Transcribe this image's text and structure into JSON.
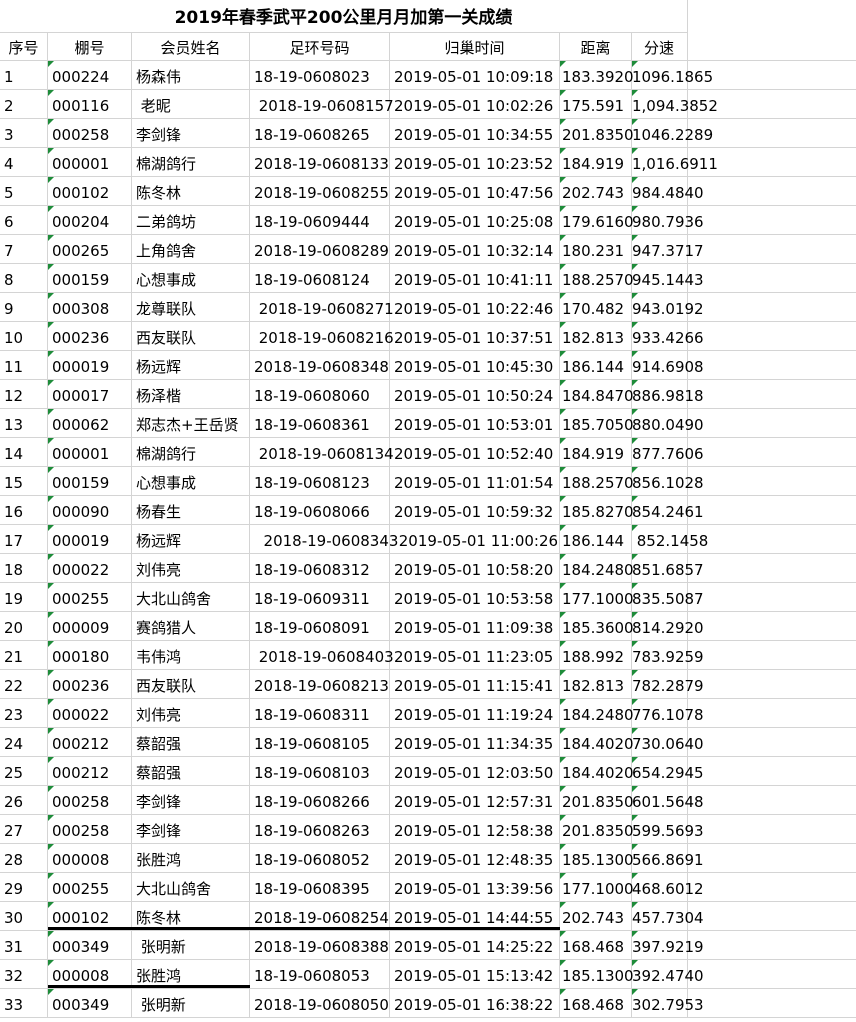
{
  "title": "2019年春季武平200公里月月加第一关成绩",
  "headers": [
    "序号",
    "棚号",
    "会员姓名",
    "足环号码",
    "归巢时间",
    "距离",
    "分速"
  ],
  "rows": [
    [
      "1",
      "000224",
      "杨森伟",
      "18-19-0608023",
      "2019-05-01 10:09:18",
      "183.3920",
      "1096.1865"
    ],
    [
      "2",
      "000116",
      " 老昵",
      " 2018-19-0608157",
      "2019-05-01 10:02:26",
      "175.591",
      "1,094.3852"
    ],
    [
      "3",
      "000258",
      "李剑锋",
      "18-19-0608265",
      "2019-05-01 10:34:55",
      "201.8350",
      "1046.2289"
    ],
    [
      "4",
      "000001",
      "棉湖鸽行",
      "2018-19-0608133",
      "2019-05-01 10:23:52",
      "184.919",
      "1,016.6911"
    ],
    [
      "5",
      "000102",
      "陈冬林",
      "2018-19-0608255",
      "2019-05-01 10:47:56",
      "202.743",
      "984.4840"
    ],
    [
      "6",
      "000204",
      "二弟鸽坊",
      "18-19-0609444",
      "2019-05-01 10:25:08",
      "179.6160",
      "980.7936"
    ],
    [
      "7",
      "000265",
      "上角鸽舍",
      "2018-19-0608289",
      "2019-05-01 10:32:14",
      "180.231",
      "947.3717"
    ],
    [
      "8",
      "000159",
      "心想事成",
      "18-19-0608124",
      "2019-05-01 10:41:11",
      "188.2570",
      "945.1443"
    ],
    [
      "9",
      "000308",
      "龙尊联队",
      " 2018-19-0608271",
      "2019-05-01 10:22:46",
      "170.482",
      "943.0192"
    ],
    [
      "10",
      "000236",
      "西友联队",
      " 2018-19-0608216",
      "2019-05-01 10:37:51",
      "182.813",
      "933.4266"
    ],
    [
      "11",
      "000019",
      "杨远辉",
      "2018-19-0608348",
      "2019-05-01 10:45:30",
      "186.144",
      "914.6908"
    ],
    [
      "12",
      "000017",
      "杨泽楷",
      "18-19-0608060",
      "2019-05-01 10:50:24",
      "184.8470",
      "886.9818"
    ],
    [
      "13",
      "000062",
      "郑志杰+王岳贤",
      "18-19-0608361",
      "2019-05-01 10:53:01",
      "185.7050",
      "880.0490"
    ],
    [
      "14",
      "000001",
      "棉湖鸽行",
      " 2018-19-0608134",
      "2019-05-01 10:52:40",
      "184.919",
      "877.7606"
    ],
    [
      "15",
      "000159",
      "心想事成",
      "18-19-0608123",
      "2019-05-01 11:01:54",
      "188.2570",
      "856.1028"
    ],
    [
      "16",
      "000090",
      "杨春生",
      "18-19-0608066",
      "2019-05-01 10:59:32",
      "185.8270",
      "854.2461"
    ],
    [
      "17",
      "000019",
      "杨远辉",
      "  2018-19-0608343",
      " 2019-05-01 11:00:26",
      "186.144",
      " 852.1458"
    ],
    [
      "18",
      "000022",
      "刘伟亮",
      "18-19-0608312",
      "2019-05-01 10:58:20",
      "184.2480",
      "851.6857"
    ],
    [
      "19",
      "000255",
      "大北山鸽舍",
      "18-19-0609311",
      "2019-05-01 10:53:58",
      "177.1000",
      "835.5087"
    ],
    [
      "20",
      "000009",
      "赛鸽猎人",
      "18-19-0608091",
      "2019-05-01 11:09:38",
      "185.3600",
      "814.2920"
    ],
    [
      "21",
      "000180",
      "韦伟鸿",
      " 2018-19-0608403",
      "2019-05-01 11:23:05",
      "188.992",
      "783.9259"
    ],
    [
      "22",
      "000236",
      "西友联队",
      "2018-19-0608213",
      "2019-05-01 11:15:41",
      "182.813",
      "782.2879"
    ],
    [
      "23",
      "000022",
      "刘伟亮",
      "18-19-0608311",
      "2019-05-01 11:19:24",
      "184.2480",
      "776.1078"
    ],
    [
      "24",
      "000212",
      "蔡韶强",
      "18-19-0608105",
      "2019-05-01 11:34:35",
      "184.4020",
      "730.0640"
    ],
    [
      "25",
      "000212",
      "蔡韶强",
      "18-19-0608103",
      "2019-05-01 12:03:50",
      "184.4020",
      "654.2945"
    ],
    [
      "26",
      "000258",
      "李剑锋",
      "18-19-0608266",
      "2019-05-01 12:57:31",
      "201.8350",
      "601.5648"
    ],
    [
      "27",
      "000258",
      "李剑锋",
      "18-19-0608263",
      "2019-05-01 12:58:38",
      "201.8350",
      "599.5693"
    ],
    [
      "28",
      "000008",
      "张胜鸿",
      "18-19-0608052",
      "2019-05-01 12:48:35",
      "185.1300",
      "566.8691"
    ],
    [
      "29",
      "000255",
      "大北山鸽舍",
      "18-19-0608395",
      "2019-05-01 13:39:56",
      "177.1000",
      "468.6012"
    ],
    [
      "30",
      "000102",
      "陈冬林",
      "2018-19-0608254",
      "2019-05-01 14:44:55",
      "202.743",
      "457.7304"
    ],
    [
      "31",
      "000349",
      " 张明新",
      "2018-19-0608388",
      "2019-05-01 14:25:22",
      "168.468",
      "397.9219"
    ],
    [
      "32",
      "000008",
      "张胜鸿",
      "18-19-0608053",
      "2019-05-01 15:13:42",
      "185.1300",
      "392.4740"
    ],
    [
      "33",
      "000349",
      " 张明新",
      "2018-19-0608050",
      "2019-05-01 16:38:22",
      "168.468",
      "302.7953"
    ]
  ]
}
